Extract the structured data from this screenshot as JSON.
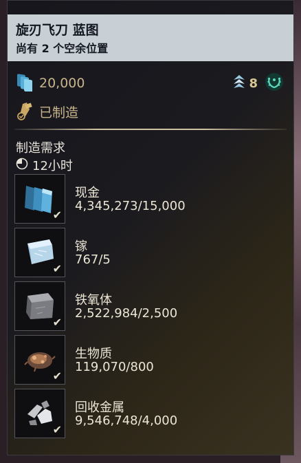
{
  "header": {
    "title": "旋刃飞刀 蓝图",
    "subtitle": "尚有 2 个空余位置"
  },
  "stats": {
    "credits": "20,000",
    "mastery_rank": "8",
    "crafted_status": "已制造"
  },
  "requirements": {
    "label": "制造需求",
    "time": "12小时"
  },
  "resources": [
    {
      "name": "现金",
      "amount": "4,345,273/15,000",
      "icon": "credits-icon"
    },
    {
      "name": "镓",
      "amount": "767/5",
      "icon": "gallium-icon"
    },
    {
      "name": "铁氧体",
      "amount": "2,522,984/2,500",
      "icon": "ferrite-icon"
    },
    {
      "name": "生物质",
      "amount": "119,070/800",
      "icon": "biomass-icon"
    },
    {
      "name": "回收金属",
      "amount": "9,546,748/4,000",
      "icon": "salvage-icon"
    }
  ],
  "check_glyph": "✔",
  "colors": {
    "header_bg": "#c8d0d6",
    "accent_gold": "#c9b58c",
    "text_light": "#ece6d6",
    "teal": "#2fa58f"
  }
}
